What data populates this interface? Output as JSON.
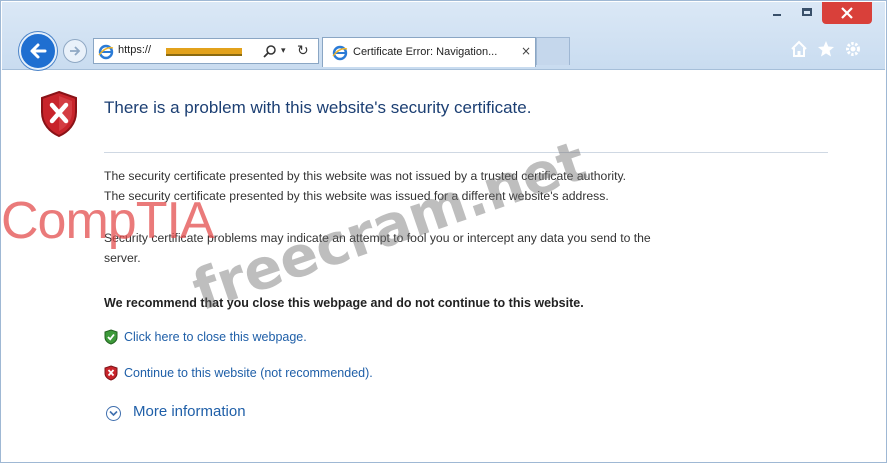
{
  "browser": {
    "address_prefix": "https://",
    "tab_title": "Certificate Error: Navigation...",
    "tab_close": "×",
    "refresh_glyph": "↻",
    "dropdown_glyph": "▾",
    "icons": [
      "back-arrow-icon",
      "forward-arrow-icon",
      "ie-logo-icon",
      "search-icon",
      "home-icon",
      "favorites-star-icon",
      "settings-gear-icon",
      "minimize-icon",
      "maximize-icon",
      "close-icon"
    ]
  },
  "page": {
    "title": "There is a problem with this website's security certificate.",
    "paragraphs": [
      "The security certificate presented by this website was not issued by a trusted certificate authority.",
      "The security certificate presented by this website was issued for a different website's address.",
      "Security certificate problems may indicate an attempt to fool you or intercept any data you send to the",
      "server."
    ],
    "recommendation": "We recommend that you close this webpage and do not continue to this website.",
    "options": [
      {
        "label": "Click here to close this webpage.",
        "icon": "green-shield-check-icon"
      },
      {
        "label": "Continue to this website (not recommended).",
        "icon": "red-shield-x-icon"
      }
    ],
    "more_information": "More information"
  },
  "watermarks": {
    "comptia": "CompTIA",
    "freecram": "freecram.net"
  },
  "colors": {
    "accent_blue": "#1f6fd1",
    "title_blue": "#1c3f73",
    "link_blue": "#1f5fa8",
    "close_red": "#d9403a",
    "shield_red": "#c8242b"
  }
}
